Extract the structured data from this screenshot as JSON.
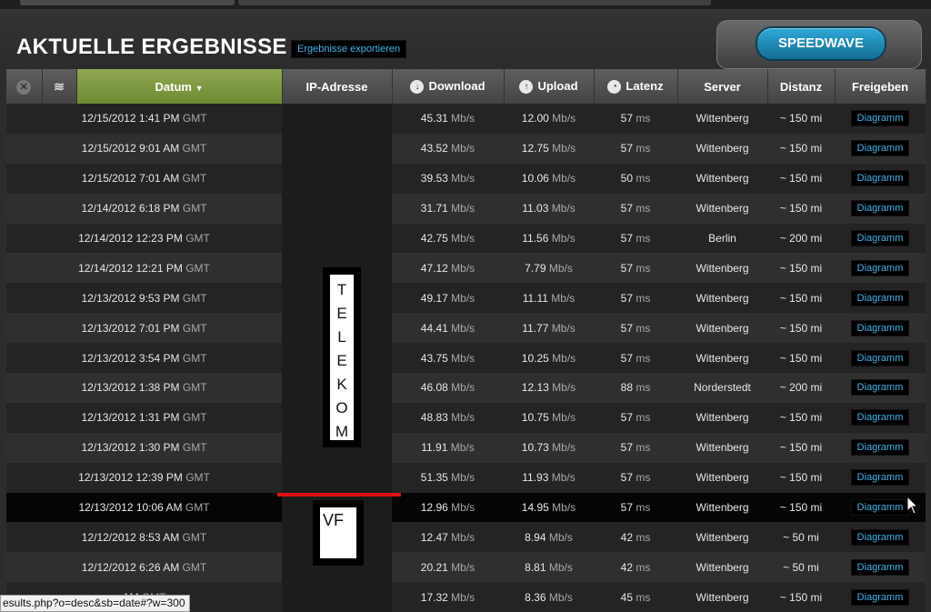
{
  "header": {
    "title": "AKTUELLE ERGEBNISSE",
    "export_label": "Ergebnisse exportieren",
    "logo_text": "SPEEDWAVE"
  },
  "columns": {
    "datum": "Datum",
    "ip": "IP-Adresse",
    "download": "Download",
    "upload": "Upload",
    "latenz": "Latenz",
    "server": "Server",
    "distanz": "Distanz",
    "freigeben": "Freigeben"
  },
  "icons": {
    "delete": "close-circle-icon",
    "filter": "layers-icon",
    "sort": "sort-down-icon",
    "download": "download-arrow-icon",
    "upload": "upload-arrow-icon",
    "latency": "gauge-icon"
  },
  "units": {
    "tz": "GMT",
    "speed": "Mb/s",
    "latency": "ms"
  },
  "share_label": "Diagramm",
  "rows": [
    {
      "datetime": "12/15/2012 1:41 PM",
      "download": "45.31",
      "upload": "12.00",
      "latenz": "57",
      "server": "Wittenberg",
      "distanz": "~ 150 mi"
    },
    {
      "datetime": "12/15/2012 9:01 AM",
      "download": "43.52",
      "upload": "12.75",
      "latenz": "57",
      "server": "Wittenberg",
      "distanz": "~ 150 mi"
    },
    {
      "datetime": "12/15/2012 7:01 AM",
      "download": "39.53",
      "upload": "10.06",
      "latenz": "50",
      "server": "Wittenberg",
      "distanz": "~ 150 mi"
    },
    {
      "datetime": "12/14/2012 6:18 PM",
      "download": "31.71",
      "upload": "11.03",
      "latenz": "57",
      "server": "Wittenberg",
      "distanz": "~ 150 mi"
    },
    {
      "datetime": "12/14/2012 12:23 PM",
      "download": "42.75",
      "upload": "11.56",
      "latenz": "57",
      "server": "Berlin",
      "distanz": "~ 200 mi"
    },
    {
      "datetime": "12/14/2012 12:21 PM",
      "download": "47.12",
      "upload": "7.79",
      "latenz": "57",
      "server": "Wittenberg",
      "distanz": "~ 150 mi"
    },
    {
      "datetime": "12/13/2012 9:53 PM",
      "download": "49.17",
      "upload": "11.11",
      "latenz": "57",
      "server": "Wittenberg",
      "distanz": "~ 150 mi"
    },
    {
      "datetime": "12/13/2012 7:01 PM",
      "download": "44.41",
      "upload": "11.77",
      "latenz": "57",
      "server": "Wittenberg",
      "distanz": "~ 150 mi"
    },
    {
      "datetime": "12/13/2012 3:54 PM",
      "download": "43.75",
      "upload": "10.25",
      "latenz": "57",
      "server": "Wittenberg",
      "distanz": "~ 150 mi"
    },
    {
      "datetime": "12/13/2012 1:38 PM",
      "download": "46.08",
      "upload": "12.13",
      "latenz": "88",
      "server": "Norderstedt",
      "distanz": "~ 200 mi"
    },
    {
      "datetime": "12/13/2012 1:31 PM",
      "download": "48.83",
      "upload": "10.75",
      "latenz": "57",
      "server": "Wittenberg",
      "distanz": "~ 150 mi"
    },
    {
      "datetime": "12/13/2012 1:30 PM",
      "download": "11.91",
      "upload": "10.73",
      "latenz": "57",
      "server": "Wittenberg",
      "distanz": "~ 150 mi"
    },
    {
      "datetime": "12/13/2012 12:39 PM",
      "download": "51.35",
      "upload": "11.93",
      "latenz": "57",
      "server": "Wittenberg",
      "distanz": "~ 150 mi"
    },
    {
      "datetime": "12/13/2012 10:06 AM",
      "download": "12.96",
      "upload": "14.95",
      "latenz": "57",
      "server": "Wittenberg",
      "distanz": "~ 150 mi",
      "highlight": true
    },
    {
      "datetime": "12/12/2012 8:53 AM",
      "download": "12.47",
      "upload": "8.94",
      "latenz": "42",
      "server": "Wittenberg",
      "distanz": "~ 50 mi"
    },
    {
      "datetime": "12/12/2012 6:26 AM",
      "download": "20.21",
      "upload": "8.81",
      "latenz": "42",
      "server": "Wittenberg",
      "distanz": "~ 50 mi"
    },
    {
      "datetime": "AM",
      "download": "17.32",
      "upload": "8.36",
      "latenz": "45",
      "server": "Wittenberg",
      "distanz": "~ 150 mi"
    }
  ],
  "overlays": {
    "telekom_letters": [
      "T",
      "E",
      "L",
      "E",
      "K",
      "O",
      "M"
    ],
    "vf_label": "VF"
  },
  "status_bar": "esults.php?o=desc&sb=date#?w=300",
  "colors": {
    "datum_header": "#7f9a42",
    "link": "#3fb6e8",
    "overlay_line": "#e11010",
    "logo": "#2fa9d8"
  }
}
